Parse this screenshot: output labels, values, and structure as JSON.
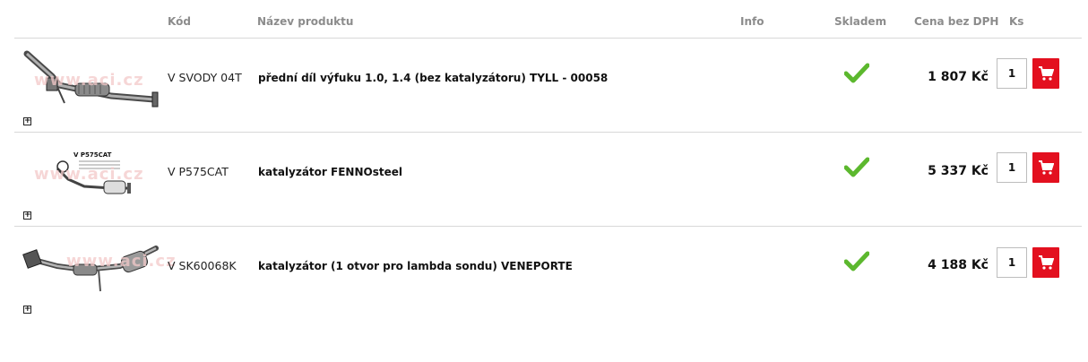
{
  "table": {
    "columns": {
      "code": "Kód",
      "name": "Název produktu",
      "info": "Info",
      "stock": "Skladem",
      "price": "Cena bez DPH",
      "qty": "Ks"
    }
  },
  "watermark": "www.aci.cz",
  "brand_color": "#e3101f",
  "stock_color": "#5cb82e",
  "products": [
    {
      "code": "V SVODY 04T",
      "name": "přední díl výfuku 1.0, 1.4 (bez katalyzátoru) TYLL - 00058",
      "in_stock": true,
      "price": "1 807 Kč",
      "quantity": "1",
      "image_icon": "exhaust-pipe-icon"
    },
    {
      "code": "V P575CAT",
      "name": "katalyzátor FENNOsteel",
      "in_stock": true,
      "price": "5 337 Kč",
      "quantity": "1",
      "image_icon": "catalyst-diagram-icon",
      "image_label": "V P575CAT"
    },
    {
      "code": "V SK60068K",
      "name": "katalyzátor (1 otvor pro lambda sondu) VENEPORTE",
      "in_stock": true,
      "price": "4 188 Kč",
      "quantity": "1",
      "image_icon": "catalyst-pipe-icon"
    }
  ]
}
